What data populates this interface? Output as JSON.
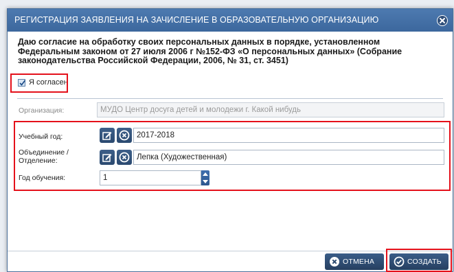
{
  "dialog": {
    "title": "РЕГИСТРАЦИЯ ЗАЯВЛЕНИЯ НА ЗАЧИСЛЕНИЕ В ОБРАЗОВАТЕЛЬНУЮ ОРГАНИЗАЦИЮ",
    "close_icon": "close-circle-icon"
  },
  "consent": {
    "text": "Даю согласие на обработку своих персональных данных в порядке, установленном Федеральным законом от 27 июля 2006 г №152-ФЗ «О персональных данных» (Собрание законодательства Российской Федерации, 2006, № 31, ст. 3451)",
    "checkbox_label": "Я согласен",
    "checked": true
  },
  "form": {
    "organization": {
      "label": "Организация:",
      "value": "МУДО Центр досуга детей и молодежи г. Какой нибудь"
    },
    "academic_year": {
      "label": "Учебный год:",
      "value": "2017-2018"
    },
    "association": {
      "label": "Объединение / Отделение:",
      "value": "Лепка (Художественная)"
    },
    "study_year": {
      "label": "Год обучения:",
      "value": "1"
    }
  },
  "buttons": {
    "cancel": "ОТМЕНА",
    "create": "СОЗДАТЬ"
  },
  "colors": {
    "titlebar": "#3c679d",
    "highlight": "#e4101a",
    "button": "#2b4a70"
  }
}
